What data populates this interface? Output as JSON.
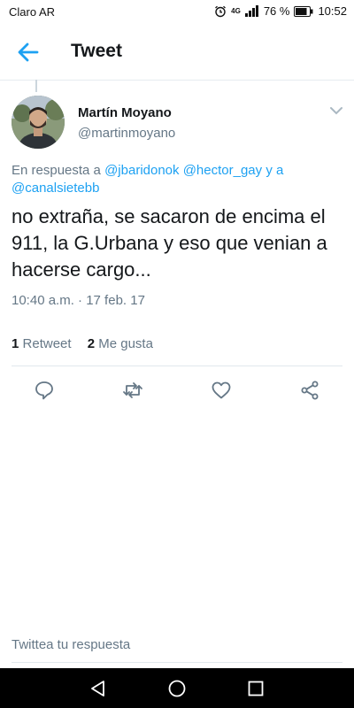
{
  "status_bar": {
    "carrier": "Claro AR",
    "network": "4G",
    "battery": "76 %",
    "time": "10:52"
  },
  "header": {
    "title": "Tweet",
    "back_icon": "arrow-left-icon"
  },
  "tweet": {
    "author_name": "Martín Moyano",
    "author_handle": "@martinmoyano",
    "reply_prefix": "En respuesta a",
    "reply_mentions": [
      "@jbaridonok",
      "@hector_gay"
    ],
    "reply_joiner": "y a",
    "reply_last": "@canalsietebb",
    "text": "no extraña, se sacaron de encima el 911, la G.Urbana y eso que venian a hacerse cargo...",
    "timestamp": "10:40 a.m. · 17 feb. 17",
    "retweets_count": "1",
    "retweets_label": "Retweet",
    "likes_count": "2",
    "likes_label": "Me gusta"
  },
  "actions": [
    "reply-icon",
    "retweet-icon",
    "heart-icon",
    "share-icon"
  ],
  "compose": {
    "placeholder": "Twittea tu respuesta"
  },
  "colors": {
    "accent": "#1da1f2",
    "muted": "#657786",
    "text": "#14171a"
  }
}
